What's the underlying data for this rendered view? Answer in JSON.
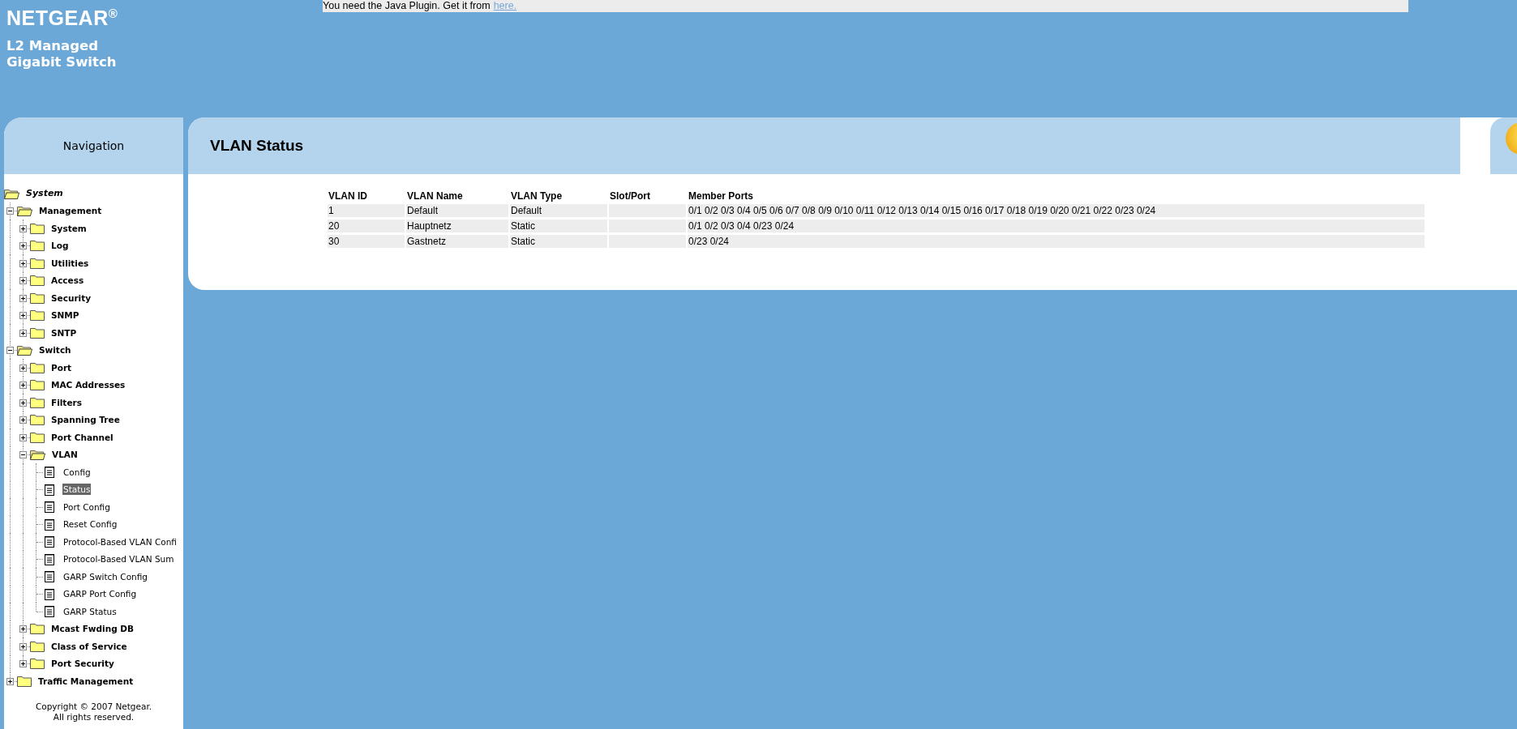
{
  "header": {
    "brand": "NETGEAR$^{®}$",
    "product_lines": [
      "L2 Managed",
      "Gigabit Switch"
    ]
  },
  "java_notice": {
    "text": "You need the Java Plugin. Get it from",
    "link": "here."
  },
  "navigation": {
    "title": "Navigation",
    "tree": [
      {
        "label": "System",
        "kind": "root",
        "expanded": true,
        "selected": false,
        "children": [
          {
            "label": "Management",
            "kind": "folder",
            "expanded": true,
            "selected": false,
            "children": [
              {
                "label": "System",
                "kind": "folder",
                "expanded": false,
                "selected": false
              },
              {
                "label": "Log",
                "kind": "folder",
                "expanded": false,
                "selected": false
              },
              {
                "label": "Utilities",
                "kind": "folder",
                "expanded": false,
                "selected": false
              },
              {
                "label": "Access",
                "kind": "folder",
                "expanded": false,
                "selected": false
              },
              {
                "label": "Security",
                "kind": "folder",
                "expanded": false,
                "selected": false
              },
              {
                "label": "SNMP",
                "kind": "folder",
                "expanded": false,
                "selected": false
              },
              {
                "label": "SNTP",
                "kind": "folder",
                "expanded": false,
                "selected": false
              }
            ]
          },
          {
            "label": "Switch",
            "kind": "folder",
            "expanded": true,
            "selected": false,
            "children": [
              {
                "label": "Port",
                "kind": "folder",
                "expanded": false,
                "selected": false
              },
              {
                "label": "MAC Addresses",
                "kind": "folder",
                "expanded": false,
                "selected": false
              },
              {
                "label": "Filters",
                "kind": "folder",
                "expanded": false,
                "selected": false
              },
              {
                "label": "Spanning Tree",
                "kind": "folder",
                "expanded": false,
                "selected": false
              },
              {
                "label": "Port Channel",
                "kind": "folder",
                "expanded": false,
                "selected": false
              },
              {
                "label": "VLAN",
                "kind": "folder",
                "expanded": true,
                "selected": false,
                "children": [
                  {
                    "label": "Config",
                    "kind": "page",
                    "selected": false
                  },
                  {
                    "label": "Status",
                    "kind": "page",
                    "selected": true
                  },
                  {
                    "label": "Port Config",
                    "kind": "page",
                    "selected": false
                  },
                  {
                    "label": "Reset Config",
                    "kind": "page",
                    "selected": false
                  },
                  {
                    "label": "Protocol-Based VLAN Confi",
                    "kind": "page",
                    "selected": false
                  },
                  {
                    "label": "Protocol-Based VLAN Sum",
                    "kind": "page",
                    "selected": false
                  },
                  {
                    "label": "GARP Switch Config",
                    "kind": "page",
                    "selected": false
                  },
                  {
                    "label": "GARP Port Config",
                    "kind": "page",
                    "selected": false
                  },
                  {
                    "label": "GARP Status",
                    "kind": "page",
                    "selected": false
                  }
                ]
              },
              {
                "label": "Mcast Fwding DB",
                "kind": "folder",
                "expanded": false,
                "selected": false
              },
              {
                "label": "Class of Service",
                "kind": "folder",
                "expanded": false,
                "selected": false
              },
              {
                "label": "Port Security",
                "kind": "folder",
                "expanded": false,
                "selected": false
              }
            ]
          },
          {
            "label": "Traffic Management",
            "kind": "folder",
            "expanded": false,
            "selected": false
          }
        ]
      }
    ],
    "copyright": [
      "Copyright © 2007 Netgear.",
      "All rights reserved."
    ]
  },
  "page": {
    "title": "VLAN Status",
    "table": {
      "columns": [
        "VLAN ID",
        "VLAN Name",
        "VLAN Type",
        "Slot/Port",
        "Member Ports"
      ],
      "rows": [
        [
          "1",
          "Default",
          "Default",
          "",
          "0/1 0/2 0/3 0/4 0/5 0/6 0/7 0/8 0/9 0/10 0/11 0/12 0/13 0/14 0/15 0/16 0/17 0/18 0/19 0/20 0/21 0/22 0/23 0/24"
        ],
        [
          "20",
          "Hauptnetz",
          "Static",
          "",
          "0/1 0/2 0/3 0/4 0/23 0/24"
        ],
        [
          "30",
          "Gastnetz",
          "Static",
          "",
          "0/23 0/24"
        ]
      ]
    }
  }
}
